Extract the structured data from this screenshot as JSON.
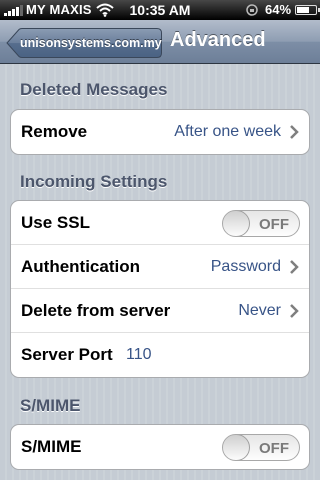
{
  "status_bar": {
    "carrier": "MY MAXIS",
    "time": "10:35 AM",
    "battery_percent": "64%",
    "icons": [
      "signal-icon",
      "wifi-icon",
      "orientation-lock-icon",
      "battery-icon"
    ]
  },
  "nav": {
    "back_label": "unisonsystems.com.my",
    "title": "Advanced"
  },
  "sections": {
    "deleted_messages": {
      "header": "Deleted Messages",
      "remove_label": "Remove",
      "remove_value": "After one week"
    },
    "incoming": {
      "header": "Incoming Settings",
      "ssl_label": "Use SSL",
      "ssl_toggle": "OFF",
      "auth_label": "Authentication",
      "auth_value": "Password",
      "delete_label": "Delete from server",
      "delete_value": "Never",
      "port_label": "Server Port",
      "port_value": "110"
    },
    "smime": {
      "header": "S/MIME",
      "smime_label": "S/MIME",
      "smime_toggle": "OFF"
    }
  },
  "colors": {
    "background": "#c5ccd4",
    "value_text": "#385487",
    "section_header": "#4c566c",
    "nav_bar": "#7d8ea6"
  }
}
